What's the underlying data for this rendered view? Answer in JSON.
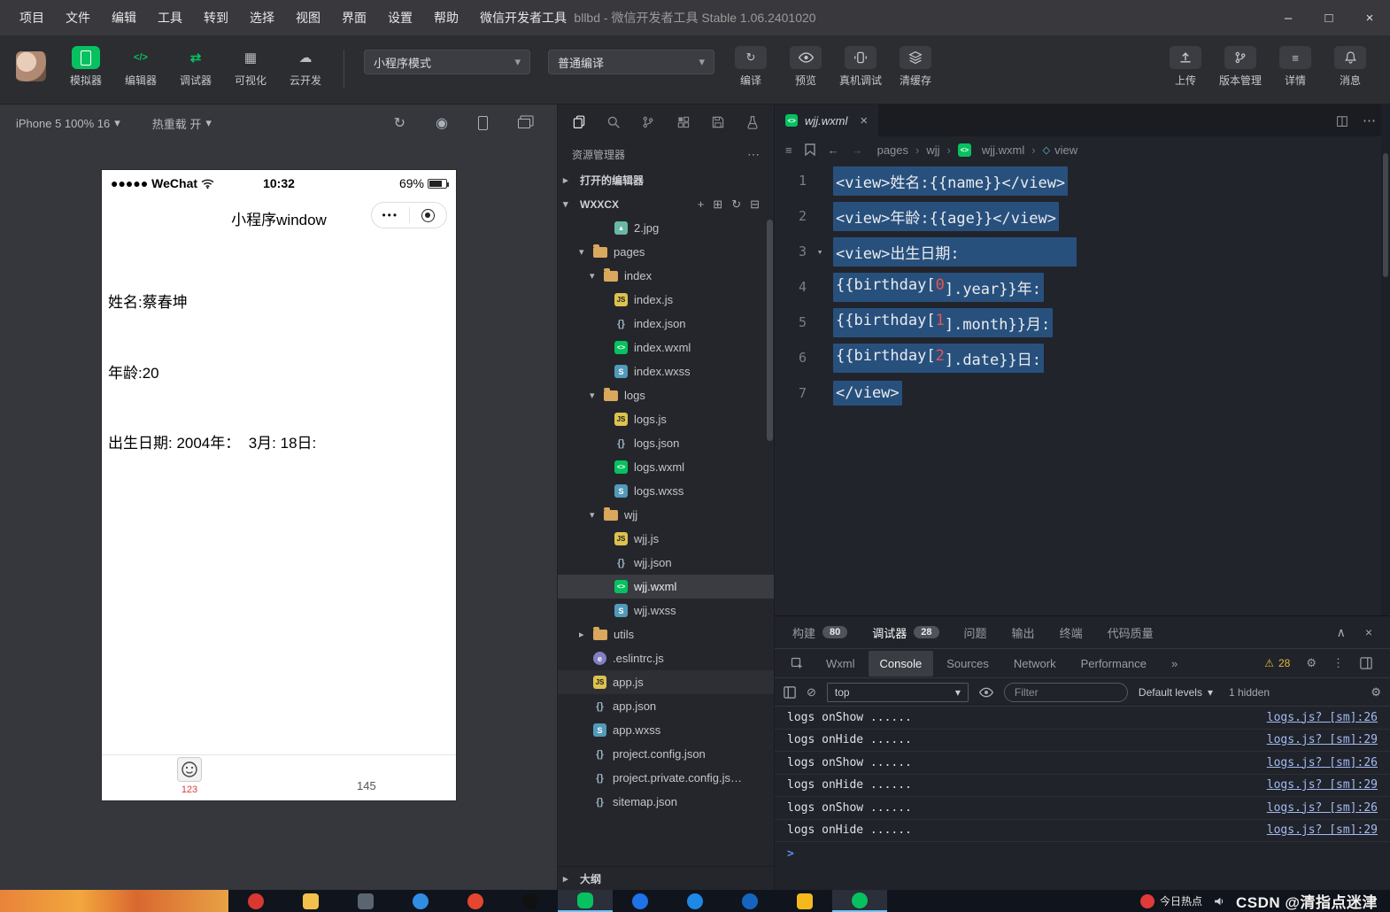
{
  "titlebar": {
    "menus": [
      "项目",
      "文件",
      "编辑",
      "工具",
      "转到",
      "选择",
      "视图",
      "界面",
      "设置",
      "帮助",
      "微信开发者工具"
    ],
    "title": "bllbd  -  微信开发者工具 Stable 1.06.2401020"
  },
  "icons": {
    "min": "–",
    "max": "□",
    "close": "×",
    "ellipsis": "⋯",
    "more": "…",
    "caret": "▾",
    "chev_right": "▸",
    "chev_down": "▾",
    "plus": "+",
    "new_folder": "⊞",
    "refresh": "↻",
    "collapse": "⊟",
    "back": "←",
    "forward": "→",
    "list": "≡",
    "split": "◫",
    "overflow": "»",
    "warn": "⚠",
    "gear": "⚙",
    "kebab": "⋮",
    "prompt": ">",
    "sep": "›",
    "block": "⊘",
    "record": "◉",
    "dots": "•••",
    "up": "∧",
    "tag": "◇"
  },
  "toolbar": {
    "nav": [
      {
        "label": "模拟器"
      },
      {
        "label": "编辑器"
      },
      {
        "label": "调试器"
      },
      {
        "label": "可视化"
      },
      {
        "label": "云开发"
      }
    ],
    "mode_select": "小程序模式",
    "compile_select": "普通编译",
    "actions": [
      {
        "label": "编译"
      },
      {
        "label": "预览"
      },
      {
        "label": "真机调试"
      },
      {
        "label": "清缓存"
      }
    ],
    "right": [
      {
        "label": "上传"
      },
      {
        "label": "版本管理"
      },
      {
        "label": "详情"
      },
      {
        "label": "消息"
      }
    ]
  },
  "simulator": {
    "device": "iPhone 5 100% 16",
    "hot_reload": "热重载 开",
    "phone": {
      "carrier": "●●●●● WeChat",
      "time": "10:32",
      "battery_pct": "69%",
      "nav_title": "小程序window",
      "lines": [
        "姓名:蔡春坤",
        "年龄:20",
        "出生日期: 2004年：  3月: 18日:"
      ],
      "caption": "123",
      "value": "145"
    }
  },
  "explorer": {
    "title": "资源管理器",
    "open_editors": "打开的编辑器",
    "project": "WXXCX",
    "outline": "大纲",
    "tree": [
      {
        "name": "2.jpg"
      },
      {
        "name": "pages"
      },
      {
        "name": "index"
      },
      {
        "name": "index.js"
      },
      {
        "name": "index.json"
      },
      {
        "name": "index.wxml"
      },
      {
        "name": "index.wxss"
      },
      {
        "name": "logs"
      },
      {
        "name": "logs.js"
      },
      {
        "name": "logs.json"
      },
      {
        "name": "logs.wxml"
      },
      {
        "name": "logs.wxss"
      },
      {
        "name": "wjj"
      },
      {
        "name": "wjj.js"
      },
      {
        "name": "wjj.json"
      },
      {
        "name": "wjj.wxml"
      },
      {
        "name": "wjj.wxss"
      },
      {
        "name": "utils"
      },
      {
        "name": ".eslintrc.js"
      },
      {
        "name": "app.js"
      },
      {
        "name": "app.json"
      },
      {
        "name": "app.wxss"
      },
      {
        "name": "project.config.json"
      },
      {
        "name": "project.private.config.js…"
      },
      {
        "name": "sitemap.json"
      }
    ]
  },
  "editor": {
    "tab": "wjj.wxml",
    "breadcrumb": [
      "pages",
      "wjj",
      "wjj.wxml",
      "view"
    ],
    "lines": [
      {
        "n": "1",
        "segs": [
          {
            "t": "<view>姓名:{{name}}</view>"
          }
        ]
      },
      {
        "n": "2",
        "segs": [
          {
            "t": "<view>年龄:{{age}}</view>"
          }
        ]
      },
      {
        "n": "3",
        "segs": [
          {
            "t": "<view>出生日期:"
          }
        ]
      },
      {
        "n": "4",
        "segs": [
          {
            "t": "{{birthday["
          },
          {
            "t": "0"
          },
          {
            "t": "].year}}年:"
          }
        ]
      },
      {
        "n": "5",
        "segs": [
          {
            "t": "{{birthday["
          },
          {
            "t": "1"
          },
          {
            "t": "].month}}月:"
          }
        ]
      },
      {
        "n": "6",
        "segs": [
          {
            "t": "{{birthday["
          },
          {
            "t": "2"
          },
          {
            "t": "].date}}日:"
          }
        ]
      },
      {
        "n": "7",
        "segs": [
          {
            "t": "</view>"
          }
        ]
      }
    ]
  },
  "debugger": {
    "tabs": [
      {
        "label": "构建",
        "badge": "80"
      },
      {
        "label": "调试器",
        "badge": "28"
      },
      {
        "label": "问题"
      },
      {
        "label": "输出"
      },
      {
        "label": "终端"
      },
      {
        "label": "代码质量"
      }
    ],
    "devtools": {
      "tabs": [
        "Wxml",
        "Console",
        "Sources",
        "Network",
        "Performance"
      ],
      "warn_count": "28",
      "context": "top",
      "filter_placeholder": "Filter",
      "levels": "Default levels",
      "hidden": "1 hidden"
    },
    "console": [
      {
        "msg": "logs onShow ......",
        "src": "logs.js? [sm]:26"
      },
      {
        "msg": "logs onHide ......",
        "src": "logs.js? [sm]:29"
      },
      {
        "msg": "logs onShow ......",
        "src": "logs.js? [sm]:26"
      },
      {
        "msg": "logs onHide ......",
        "src": "logs.js? [sm]:29"
      },
      {
        "msg": "logs onShow ......",
        "src": "logs.js? [sm]:26"
      },
      {
        "msg": "logs onHide ......",
        "src": "logs.js? [sm]:29"
      }
    ]
  },
  "taskbar": {
    "hotspot": "今日热点",
    "watermark": "CSDN @清指点迷津"
  }
}
